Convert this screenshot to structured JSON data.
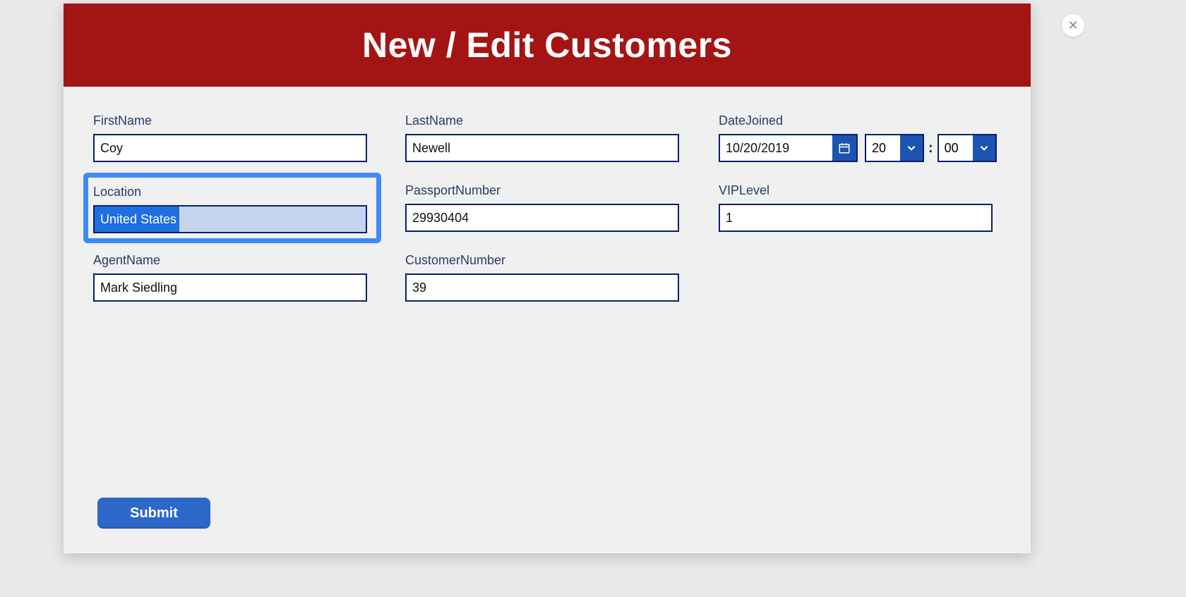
{
  "modal": {
    "title": "New / Edit Customers"
  },
  "fields": {
    "firstName": {
      "label": "FirstName",
      "value": "Coy"
    },
    "lastName": {
      "label": "LastName",
      "value": "Newell"
    },
    "dateJoined": {
      "label": "DateJoined",
      "date": "10/20/2019",
      "hour": "20",
      "minute": "00"
    },
    "location": {
      "label": "Location",
      "value": "United States"
    },
    "passportNumber": {
      "label": "PassportNumber",
      "value": "29930404"
    },
    "vipLevel": {
      "label": "VIPLevel",
      "value": "1"
    },
    "agentName": {
      "label": "AgentName",
      "value": "Mark Siedling"
    },
    "customerNumber": {
      "label": "CustomerNumber",
      "value": "39"
    }
  },
  "buttons": {
    "submit": "Submit",
    "close": "✕"
  }
}
